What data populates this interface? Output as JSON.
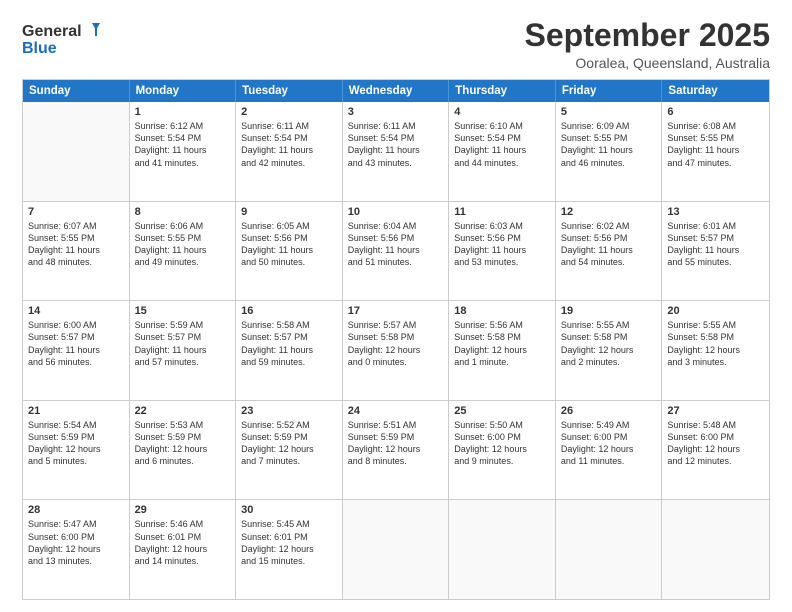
{
  "logo": {
    "general": "General",
    "blue": "Blue"
  },
  "title": {
    "month": "September 2025",
    "location": "Ooralea, Queensland, Australia"
  },
  "header_days": [
    "Sunday",
    "Monday",
    "Tuesday",
    "Wednesday",
    "Thursday",
    "Friday",
    "Saturday"
  ],
  "weeks": [
    [
      {
        "day": "",
        "info": ""
      },
      {
        "day": "1",
        "info": "Sunrise: 6:12 AM\nSunset: 5:54 PM\nDaylight: 11 hours\nand 41 minutes."
      },
      {
        "day": "2",
        "info": "Sunrise: 6:11 AM\nSunset: 5:54 PM\nDaylight: 11 hours\nand 42 minutes."
      },
      {
        "day": "3",
        "info": "Sunrise: 6:11 AM\nSunset: 5:54 PM\nDaylight: 11 hours\nand 43 minutes."
      },
      {
        "day": "4",
        "info": "Sunrise: 6:10 AM\nSunset: 5:54 PM\nDaylight: 11 hours\nand 44 minutes."
      },
      {
        "day": "5",
        "info": "Sunrise: 6:09 AM\nSunset: 5:55 PM\nDaylight: 11 hours\nand 46 minutes."
      },
      {
        "day": "6",
        "info": "Sunrise: 6:08 AM\nSunset: 5:55 PM\nDaylight: 11 hours\nand 47 minutes."
      }
    ],
    [
      {
        "day": "7",
        "info": "Sunrise: 6:07 AM\nSunset: 5:55 PM\nDaylight: 11 hours\nand 48 minutes."
      },
      {
        "day": "8",
        "info": "Sunrise: 6:06 AM\nSunset: 5:55 PM\nDaylight: 11 hours\nand 49 minutes."
      },
      {
        "day": "9",
        "info": "Sunrise: 6:05 AM\nSunset: 5:56 PM\nDaylight: 11 hours\nand 50 minutes."
      },
      {
        "day": "10",
        "info": "Sunrise: 6:04 AM\nSunset: 5:56 PM\nDaylight: 11 hours\nand 51 minutes."
      },
      {
        "day": "11",
        "info": "Sunrise: 6:03 AM\nSunset: 5:56 PM\nDaylight: 11 hours\nand 53 minutes."
      },
      {
        "day": "12",
        "info": "Sunrise: 6:02 AM\nSunset: 5:56 PM\nDaylight: 11 hours\nand 54 minutes."
      },
      {
        "day": "13",
        "info": "Sunrise: 6:01 AM\nSunset: 5:57 PM\nDaylight: 11 hours\nand 55 minutes."
      }
    ],
    [
      {
        "day": "14",
        "info": "Sunrise: 6:00 AM\nSunset: 5:57 PM\nDaylight: 11 hours\nand 56 minutes."
      },
      {
        "day": "15",
        "info": "Sunrise: 5:59 AM\nSunset: 5:57 PM\nDaylight: 11 hours\nand 57 minutes."
      },
      {
        "day": "16",
        "info": "Sunrise: 5:58 AM\nSunset: 5:57 PM\nDaylight: 11 hours\nand 59 minutes."
      },
      {
        "day": "17",
        "info": "Sunrise: 5:57 AM\nSunset: 5:58 PM\nDaylight: 12 hours\nand 0 minutes."
      },
      {
        "day": "18",
        "info": "Sunrise: 5:56 AM\nSunset: 5:58 PM\nDaylight: 12 hours\nand 1 minute."
      },
      {
        "day": "19",
        "info": "Sunrise: 5:55 AM\nSunset: 5:58 PM\nDaylight: 12 hours\nand 2 minutes."
      },
      {
        "day": "20",
        "info": "Sunrise: 5:55 AM\nSunset: 5:58 PM\nDaylight: 12 hours\nand 3 minutes."
      }
    ],
    [
      {
        "day": "21",
        "info": "Sunrise: 5:54 AM\nSunset: 5:59 PM\nDaylight: 12 hours\nand 5 minutes."
      },
      {
        "day": "22",
        "info": "Sunrise: 5:53 AM\nSunset: 5:59 PM\nDaylight: 12 hours\nand 6 minutes."
      },
      {
        "day": "23",
        "info": "Sunrise: 5:52 AM\nSunset: 5:59 PM\nDaylight: 12 hours\nand 7 minutes."
      },
      {
        "day": "24",
        "info": "Sunrise: 5:51 AM\nSunset: 5:59 PM\nDaylight: 12 hours\nand 8 minutes."
      },
      {
        "day": "25",
        "info": "Sunrise: 5:50 AM\nSunset: 6:00 PM\nDaylight: 12 hours\nand 9 minutes."
      },
      {
        "day": "26",
        "info": "Sunrise: 5:49 AM\nSunset: 6:00 PM\nDaylight: 12 hours\nand 11 minutes."
      },
      {
        "day": "27",
        "info": "Sunrise: 5:48 AM\nSunset: 6:00 PM\nDaylight: 12 hours\nand 12 minutes."
      }
    ],
    [
      {
        "day": "28",
        "info": "Sunrise: 5:47 AM\nSunset: 6:00 PM\nDaylight: 12 hours\nand 13 minutes."
      },
      {
        "day": "29",
        "info": "Sunrise: 5:46 AM\nSunset: 6:01 PM\nDaylight: 12 hours\nand 14 minutes."
      },
      {
        "day": "30",
        "info": "Sunrise: 5:45 AM\nSunset: 6:01 PM\nDaylight: 12 hours\nand 15 minutes."
      },
      {
        "day": "",
        "info": ""
      },
      {
        "day": "",
        "info": ""
      },
      {
        "day": "",
        "info": ""
      },
      {
        "day": "",
        "info": ""
      }
    ]
  ]
}
